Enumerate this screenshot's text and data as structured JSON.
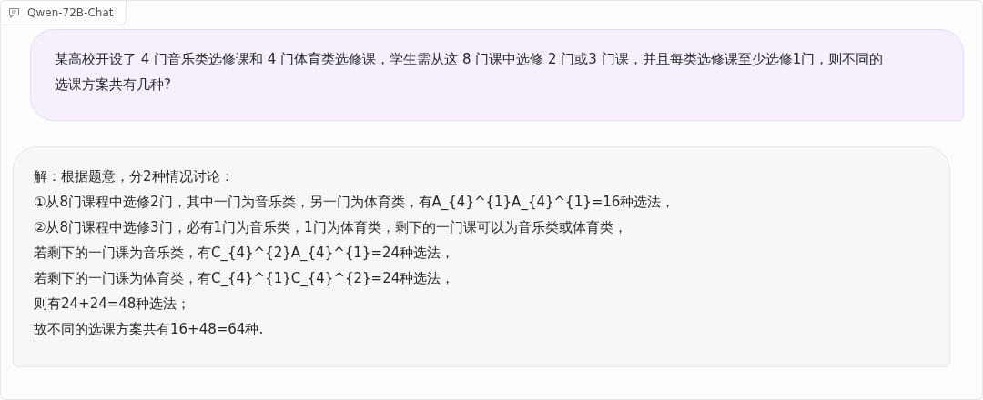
{
  "chatbot": {
    "label": "Qwen-72B-Chat"
  },
  "messages": [
    {
      "kind": "user",
      "lines": [
        "某高校开设了 4 门音乐类选修课和 4 门体育类选修课，学生需从这 8 门课中选修 2 门或3 门课，并且每类选修课至少选修1门，则不同的选课方案共有几种?"
      ]
    },
    {
      "kind": "bot",
      "lines": [
        "解：根据题意，分2种情况讨论：",
        "①从8门课程中选修2门，其中一门为音乐类，另一门为体育类，有A_{4}^{1}A_{4}^{1}=16种选法，",
        "②从8门课程中选修3门，必有1门为音乐类，1门为体育类，剩下的一门课可以为音乐类或体育类，",
        "若剩下的一门课为音乐类，有C_{4}^{2}A_{4}^{1}=24种选法，",
        "若剩下的一门课为体育类，有C_{4}^{1}C_{4}^{2}=24种选法，",
        "则有24+24=48种选法；",
        "故不同的选课方案共有16+48=64种."
      ]
    }
  ]
}
